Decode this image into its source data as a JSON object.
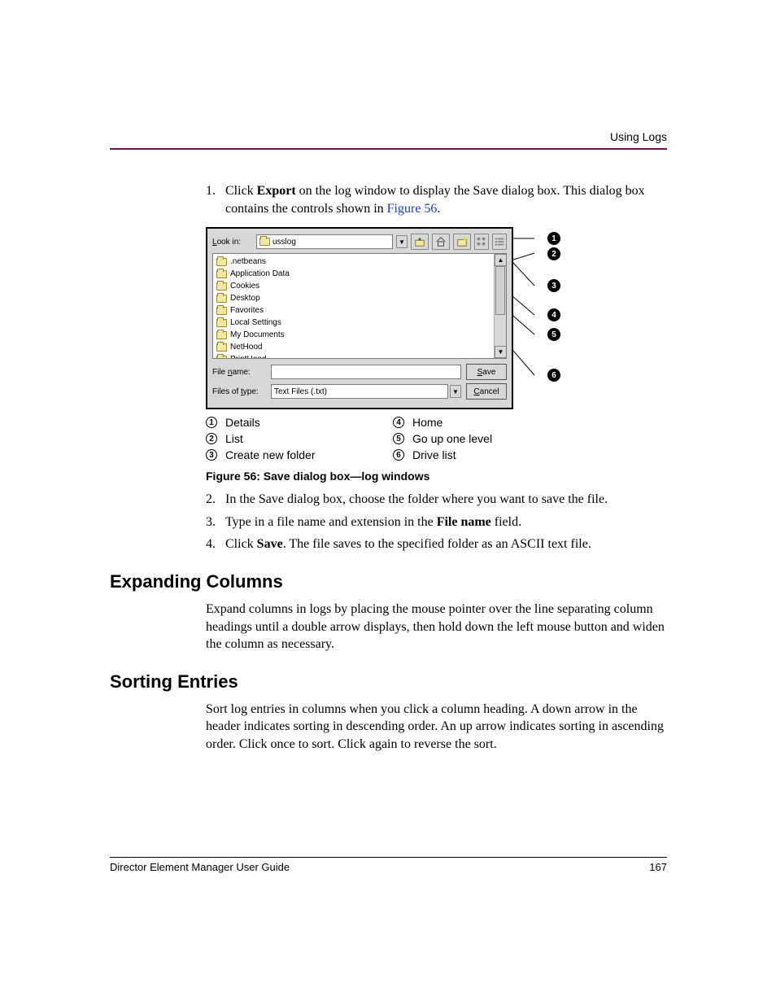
{
  "header": {
    "section": "Using Logs"
  },
  "steps_top": [
    {
      "n": "1.",
      "pre": "Click ",
      "bold": "Export",
      "post": " on the log window to display the Save dialog box. This dialog box contains the controls shown in ",
      "link": "Figure 56",
      "tail": "."
    }
  ],
  "dialog": {
    "look_in_label": "Look in:",
    "look_in_value": "usslog",
    "items": [
      ".netbeans",
      "Application Data",
      "Cookies",
      "Desktop",
      "Favorites",
      "Local Settings",
      "My Documents",
      "NetHood",
      "PrintHood"
    ],
    "file_name_label": "File name:",
    "file_name_value": "",
    "files_type_label": "Files of type:",
    "files_type_value": "Text Files (.txt)",
    "save_btn": "Save",
    "cancel_btn": "Cancel"
  },
  "callouts": [
    "1",
    "2",
    "3",
    "4",
    "5",
    "6"
  ],
  "legend": {
    "left": [
      {
        "n": "1",
        "t": "Details"
      },
      {
        "n": "2",
        "t": "List"
      },
      {
        "n": "3",
        "t": "Create new folder"
      }
    ],
    "right": [
      {
        "n": "4",
        "t": "Home"
      },
      {
        "n": "5",
        "t": "Go up one level"
      },
      {
        "n": "6",
        "t": "Drive list"
      }
    ]
  },
  "caption": "Figure 56:  Save dialog box—log windows",
  "steps_bottom": [
    {
      "n": "2.",
      "txt": "In the Save dialog box, choose the folder where you want to save the file."
    },
    {
      "n": "3.",
      "pre": "Type in a file name and extension in the ",
      "bold": "File name",
      "post": " field."
    },
    {
      "n": "4.",
      "pre": "Click ",
      "bold": "Save",
      "post": ". The file saves to the specified folder as an ASCII text file."
    }
  ],
  "sections": {
    "expanding_title": "Expanding Columns",
    "expanding_body": "Expand columns in logs by placing the mouse pointer over the line separating column headings until a double arrow displays, then hold down the left mouse button and widen the column as necessary.",
    "sorting_title": "Sorting Entries",
    "sorting_body": "Sort log entries in columns when you click a column heading. A down arrow in the header indicates sorting in descending order. An up arrow indicates sorting in ascending order. Click once to sort. Click again to reverse the sort."
  },
  "footer": {
    "left": "Director Element Manager User Guide",
    "right": "167"
  }
}
